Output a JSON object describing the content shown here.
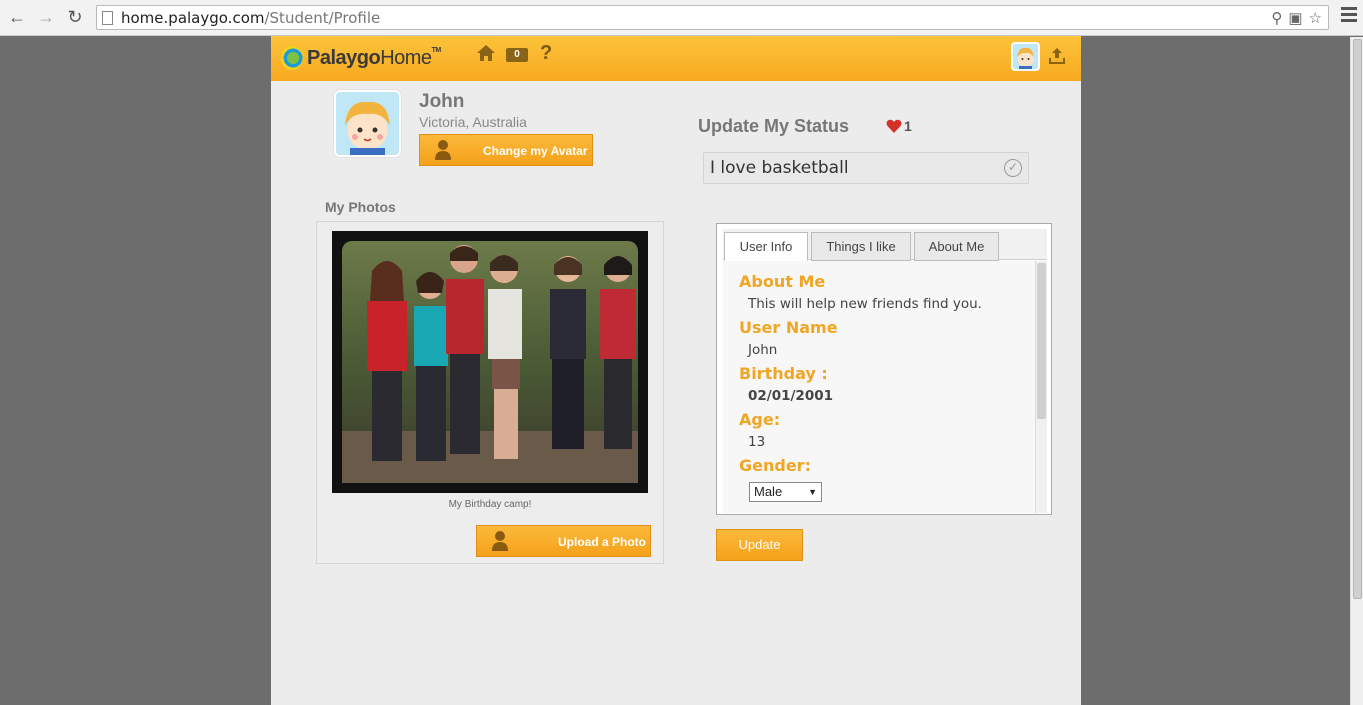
{
  "browser": {
    "url_host": "home.palaygo.com",
    "url_path": "/Student/Profile"
  },
  "header": {
    "logo_brand": "Palaygo",
    "logo_suffix": "Home",
    "logo_tm": "TM",
    "mail_count": "0",
    "help_label": "?"
  },
  "profile": {
    "name": "John",
    "location": "Victoria, Australia",
    "change_avatar_label": "Change my Avatar"
  },
  "status": {
    "title": "Update My Status",
    "likes": "1",
    "value": "I love basketball"
  },
  "photos": {
    "title": "My Photos",
    "caption": "My Birthday camp!",
    "upload_label": "Upload a Photo"
  },
  "tabs": [
    {
      "label": "User Info"
    },
    {
      "label": "Things I like"
    },
    {
      "label": "About Me"
    }
  ],
  "user_info": {
    "about_label": "About Me",
    "about_value": "This will help new friends find you.",
    "username_label": "User Name",
    "username_value": "John",
    "birthday_label": "Birthday :",
    "birthday_value": "02/01/2001",
    "age_label": "Age:",
    "age_value": "13",
    "gender_label": "Gender:",
    "gender_value": "Male"
  },
  "update_label": "Update",
  "colors": {
    "accent": "#f7a920",
    "label_orange": "#f0a624"
  }
}
